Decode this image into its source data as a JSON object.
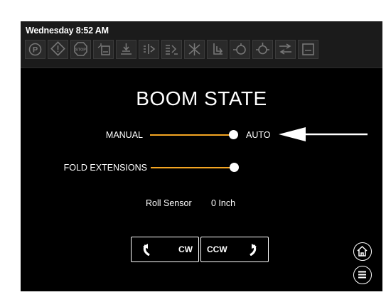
{
  "header": {
    "timestamp": "Wednesday 8:52 AM",
    "status_icons": [
      "parking-brake-icon",
      "warning-icon",
      "stop-icon",
      "tank-icon",
      "boom-height-icon",
      "boom-section-icon",
      "boom-fold-icon",
      "boom-tilt-icon",
      "boom-lift-icon",
      "pump-icon",
      "agitator-icon",
      "rinse-icon",
      "display-icon"
    ],
    "stop_text": "STOP"
  },
  "main": {
    "title": "BOOM STATE",
    "mode_toggle": {
      "left_label": "MANUAL",
      "right_label": "AUTO",
      "state": "AUTO"
    },
    "fold_extensions": {
      "label": "FOLD EXTENSIONS",
      "state": "on"
    },
    "roll_sensor": {
      "label": "Roll Sensor",
      "value": "0 Inch"
    },
    "rotate_buttons": {
      "cw_label": "CW",
      "ccw_label": "CCW"
    }
  },
  "nav": {
    "home_icon": "home-icon",
    "menu_icon": "menu-icon"
  },
  "colors": {
    "accent": "#f5a623",
    "background": "#000000",
    "text": "#ffffff"
  }
}
